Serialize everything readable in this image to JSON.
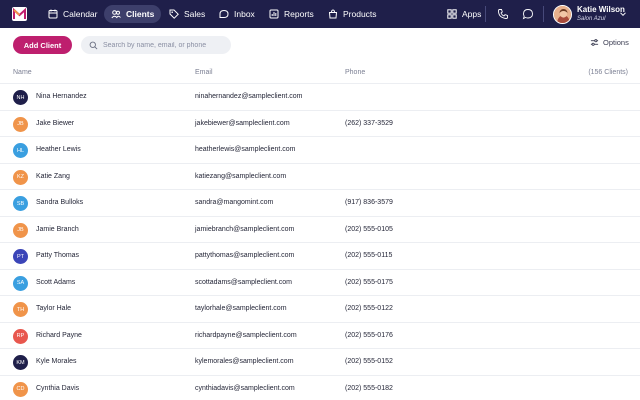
{
  "nav": {
    "logo_icon": "mangomint-logo",
    "items": [
      {
        "label": "Calendar",
        "icon": "calendar-icon"
      },
      {
        "label": "Clients",
        "icon": "users-icon",
        "active": true
      },
      {
        "label": "Sales",
        "icon": "tag-icon"
      },
      {
        "label": "Inbox",
        "icon": "inbox-icon"
      },
      {
        "label": "Reports",
        "icon": "bar-chart-icon"
      },
      {
        "label": "Products",
        "icon": "bag-icon"
      }
    ],
    "apps_label": "Apps",
    "user": {
      "name": "Katie Wilson",
      "location": "Salon Azul"
    },
    "colors": {
      "bar": "#1f1f4a",
      "active": "#3d3f6b"
    }
  },
  "toolbar": {
    "add_label": "Add Client",
    "search_placeholder": "Search by name, email, or phone",
    "options_label": "Options",
    "accent": "#be1f6e"
  },
  "table": {
    "headers": {
      "name": "Name",
      "email": "Email",
      "phone": "Phone",
      "count": "(156 Clients)"
    },
    "rows": [
      {
        "initials": "NH",
        "color": "#1f1f4a",
        "name": "Nina Hernandez",
        "email": "ninahernandez@sampleclient.com",
        "phone": ""
      },
      {
        "initials": "JB",
        "color": "#f0944a",
        "name": "Jake Biewer",
        "email": "jakebiewer@sampleclient.com",
        "phone": "(262) 337-3529"
      },
      {
        "initials": "HL",
        "color": "#3a9fe0",
        "name": "Heather Lewis",
        "email": "heatherlewis@sampleclient.com",
        "phone": ""
      },
      {
        "initials": "KZ",
        "color": "#f0944a",
        "name": "Katie Zang",
        "email": "katiezang@sampleclient.com",
        "phone": ""
      },
      {
        "initials": "SB",
        "color": "#3a9fe0",
        "name": "Sandra Bulloks",
        "email": "sandra@mangomint.com",
        "phone": "(917) 836-3579"
      },
      {
        "initials": "JB",
        "color": "#f0944a",
        "name": "Jamie Branch",
        "email": "jamiebranch@sampleclient.com",
        "phone": "(202) 555-0105"
      },
      {
        "initials": "PT",
        "color": "#3b45b8",
        "name": "Patty Thomas",
        "email": "pattythomas@sampleclient.com",
        "phone": "(202) 555-0115"
      },
      {
        "initials": "SA",
        "color": "#3a9fe0",
        "name": "Scott Adams",
        "email": "scottadams@sampleclient.com",
        "phone": "(202) 555-0175"
      },
      {
        "initials": "TH",
        "color": "#f0944a",
        "name": "Taylor Hale",
        "email": "taylorhale@sampleclient.com",
        "phone": "(202) 555-0122"
      },
      {
        "initials": "RP",
        "color": "#e8574e",
        "name": "Richard Payne",
        "email": "richardpayne@sampleclient.com",
        "phone": "(202) 555-0176"
      },
      {
        "initials": "KM",
        "color": "#1f1f4a",
        "name": "Kyle Morales",
        "email": "kylemorales@sampleclient.com",
        "phone": "(202) 555-0152"
      },
      {
        "initials": "CD",
        "color": "#f0944a",
        "name": "Cynthia Davis",
        "email": "cynthiadavis@sampleclient.com",
        "phone": "(202) 555-0182"
      }
    ]
  }
}
